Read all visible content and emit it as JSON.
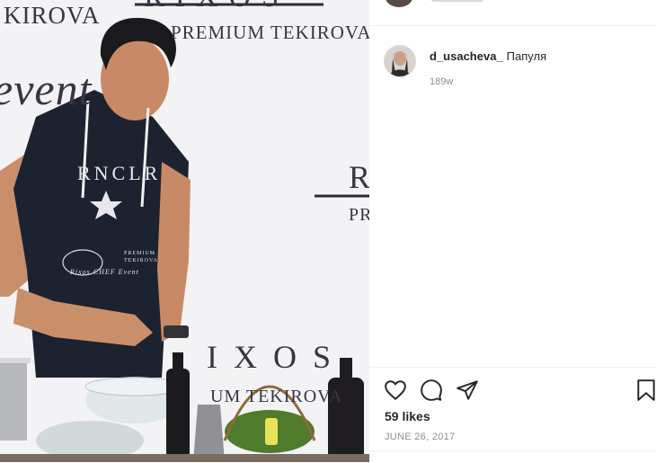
{
  "photo": {
    "banner_brand_top": "RIXOS",
    "banner_tagline_top": "PREMIUM TEKIROVA",
    "banner_script": "event",
    "banner_brand_right": "R",
    "banner_tagline_right": "PR",
    "banner_brand_bottom": "IXOS",
    "banner_tagline_bottom": "UM TEKIROVA",
    "banner_left_fragment": "KIROVA",
    "shirt_text": "RNCLR",
    "apron_text_1": "PREMIUM",
    "apron_text_2": "TEKIROVA",
    "apron_text_3": "Rixos CHEF Event"
  },
  "comment": {
    "username": "d_usacheva_",
    "text": "Папуля",
    "time": "189w"
  },
  "actions": {
    "like_icon": "heart-icon",
    "comment_icon": "comment-bubble-icon",
    "share_icon": "paper-plane-icon",
    "save_icon": "bookmark-icon"
  },
  "likes_text": "59 likes",
  "date_text": "JUNE 26, 2017"
}
